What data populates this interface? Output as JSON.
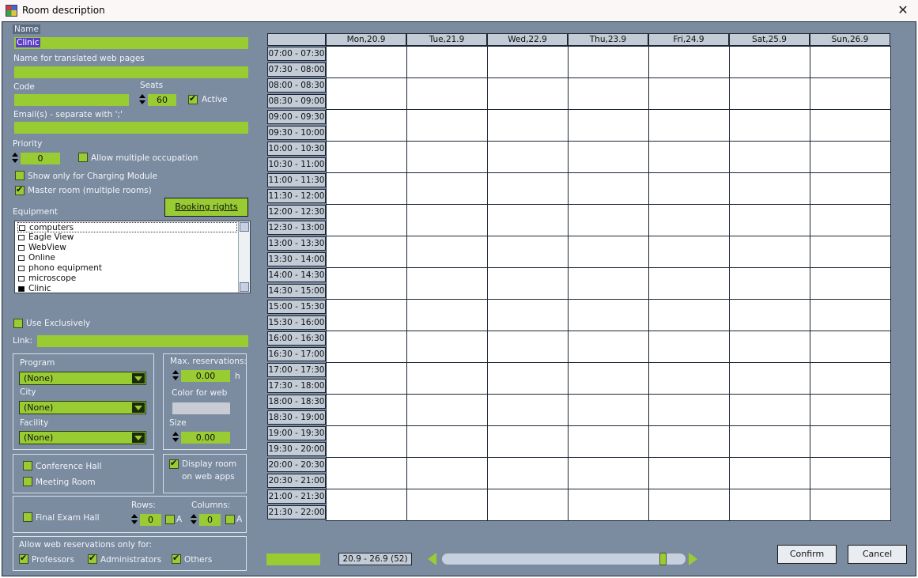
{
  "window": {
    "title": "Room description",
    "close_glyph": "✕"
  },
  "form": {
    "name_label": "Name",
    "name_value": "Clinic",
    "translated_label": "Name for translated web pages",
    "code_label": "Code",
    "seats_label": "Seats",
    "seats_value": "60",
    "active_label": "Active",
    "email_label": "Email(s) - separate with ';'",
    "priority_label": "Priority",
    "priority_value": "0",
    "allow_multiple_label": "Allow multiple occupation",
    "charging_label": "Show only for Charging Module",
    "master_label": "Master room (multiple rooms)",
    "equipment_label": "Equipment",
    "booking_rights_label": "Booking rights",
    "equipment": [
      {
        "label": "computers",
        "checked": false
      },
      {
        "label": "Eagle View",
        "checked": false
      },
      {
        "label": "WebView",
        "checked": false
      },
      {
        "label": "Online",
        "checked": false
      },
      {
        "label": "phono equipment",
        "checked": false
      },
      {
        "label": "microscope",
        "checked": false
      },
      {
        "label": "Clinic",
        "checked": true
      }
    ],
    "use_exclusively_label": "Use Exclusively",
    "link_label": "Link:",
    "program_label": "Program",
    "program_value": "(None)",
    "city_label": "City",
    "city_value": "(None)",
    "facility_label": "Facility",
    "facility_value": "(None)",
    "max_res_label": "Max. reservations:",
    "max_res_value": "0.00",
    "max_res_unit": "h",
    "color_web_label": "Color for web",
    "size_label": "Size",
    "size_value": "0.00",
    "conference_label": "Conference Hall",
    "meeting_label": "Meeting Room",
    "display_room_line1": "Display room",
    "display_room_line2": "on web apps",
    "final_exam_label": "Final Exam Hall",
    "rows_label": "Rows:",
    "rows_value": "0",
    "columns_label": "Columns:",
    "columns_value": "0",
    "a_label": "A",
    "allow_web_label": "Allow web reservations only for:",
    "professors_label": "Professors",
    "administrators_label": "Administrators",
    "others_label": "Others"
  },
  "calendar": {
    "days": [
      "Mon,20.9",
      "Tue,21.9",
      "Wed,22.9",
      "Thu,23.9",
      "Fri,24.9",
      "Sat,25.9",
      "Sun,26.9"
    ],
    "times": [
      "07:00 - 07:30",
      "07:30 - 08:00",
      "08:00 - 08:30",
      "08:30 - 09:00",
      "09:00 - 09:30",
      "09:30 - 10:00",
      "10:00 - 10:30",
      "10:30 - 11:00",
      "11:00 - 11:30",
      "11:30 - 12:00",
      "12:00 - 12:30",
      "12:30 - 13:00",
      "13:00 - 13:30",
      "13:30 - 14:00",
      "14:00 - 14:30",
      "14:30 - 15:00",
      "15:00 - 15:30",
      "15:30 - 16:00",
      "16:00 - 16:30",
      "16:30 - 17:00",
      "17:00 - 17:30",
      "17:30 - 18:00",
      "18:00 - 18:30",
      "18:30 - 19:00",
      "19:00 - 19:30",
      "19:30 - 20:00",
      "20:00 - 20:30",
      "20:30 - 21:00",
      "21:00 - 21:30",
      "21:30 - 22:00"
    ],
    "week_range": "20.9 - 26.9  (52)",
    "slider_fraction": 0.92
  },
  "buttons": {
    "confirm": "Confirm",
    "cancel": "Cancel"
  },
  "colors": {
    "accent_green": "#99cc33",
    "panel_bg": "#7b8ba0",
    "header_bg": "#c2cbd6"
  }
}
